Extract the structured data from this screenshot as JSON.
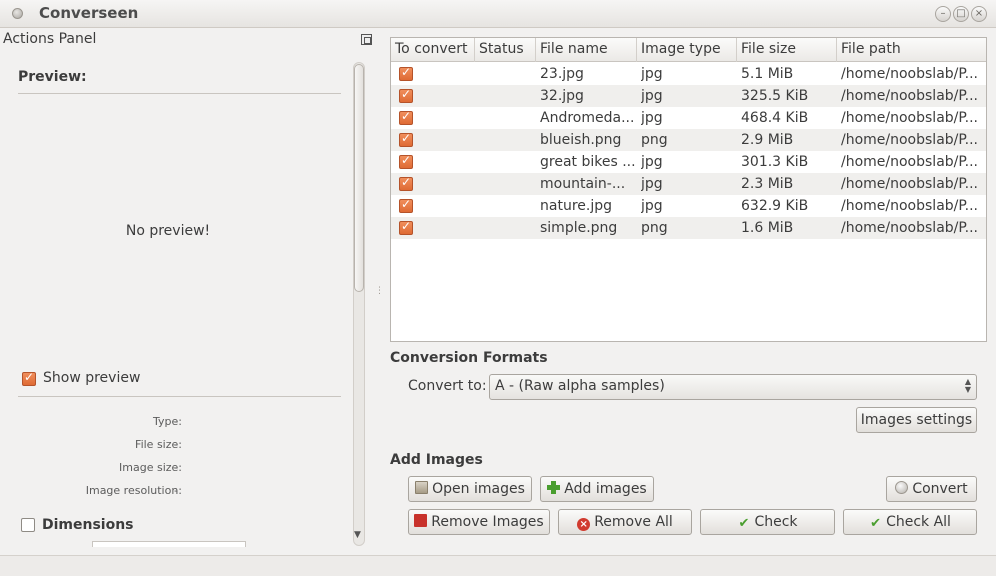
{
  "window": {
    "title": "Converseen"
  },
  "left_panel": {
    "title": "Actions Panel",
    "preview_title": "Preview:",
    "no_preview": "No preview!",
    "show_preview": {
      "label": "Show preview",
      "checked": true
    },
    "info": [
      {
        "label": "Type:",
        "value": "-"
      },
      {
        "label": "File size:",
        "value": "-"
      },
      {
        "label": "Image size:",
        "value": "-"
      },
      {
        "label": "Image resolution:",
        "value": "-"
      }
    ],
    "dimensions": {
      "label": "Dimensions",
      "checked": false
    }
  },
  "table": {
    "headers": [
      "To convert",
      "Status",
      "File name",
      "Image type",
      "File size",
      "File path"
    ],
    "rows": [
      {
        "checked": true,
        "status": "",
        "name": "23.jpg",
        "type": "jpg",
        "size": "5.1 MiB",
        "path": "/home/noobslab/P..."
      },
      {
        "checked": true,
        "status": "",
        "name": "32.jpg",
        "type": "jpg",
        "size": "325.5 KiB",
        "path": "/home/noobslab/P..."
      },
      {
        "checked": true,
        "status": "",
        "name": "Andromeda...",
        "type": "jpg",
        "size": "468.4 KiB",
        "path": "/home/noobslab/P..."
      },
      {
        "checked": true,
        "status": "",
        "name": "blueish.png",
        "type": "png",
        "size": "2.9 MiB",
        "path": "/home/noobslab/P..."
      },
      {
        "checked": true,
        "status": "",
        "name": "great bikes ...",
        "type": "jpg",
        "size": "301.3 KiB",
        "path": "/home/noobslab/P..."
      },
      {
        "checked": true,
        "status": "",
        "name": "mountain-...",
        "type": "jpg",
        "size": "2.3 MiB",
        "path": "/home/noobslab/P..."
      },
      {
        "checked": true,
        "status": "",
        "name": "nature.jpg",
        "type": "jpg",
        "size": "632.9 KiB",
        "path": "/home/noobslab/P..."
      },
      {
        "checked": true,
        "status": "",
        "name": "simple.png",
        "type": "png",
        "size": "1.6 MiB",
        "path": "/home/noobslab/P..."
      }
    ]
  },
  "conversion": {
    "title": "Conversion Formats",
    "convert_to_label": "Convert to:",
    "selected_format": "A - (Raw alpha samples)",
    "images_settings": "Images settings"
  },
  "add_images": {
    "title": "Add Images",
    "open_images": "Open images",
    "add_images": "Add images",
    "convert": "Convert",
    "remove_images": "Remove Images",
    "remove_all": "Remove All",
    "check": "Check",
    "check_all": "Check All"
  },
  "colors": {
    "accent_checkbox": "#df6a34",
    "add_icon": "#4a9e2f",
    "remove_icon": "#c8322b"
  }
}
